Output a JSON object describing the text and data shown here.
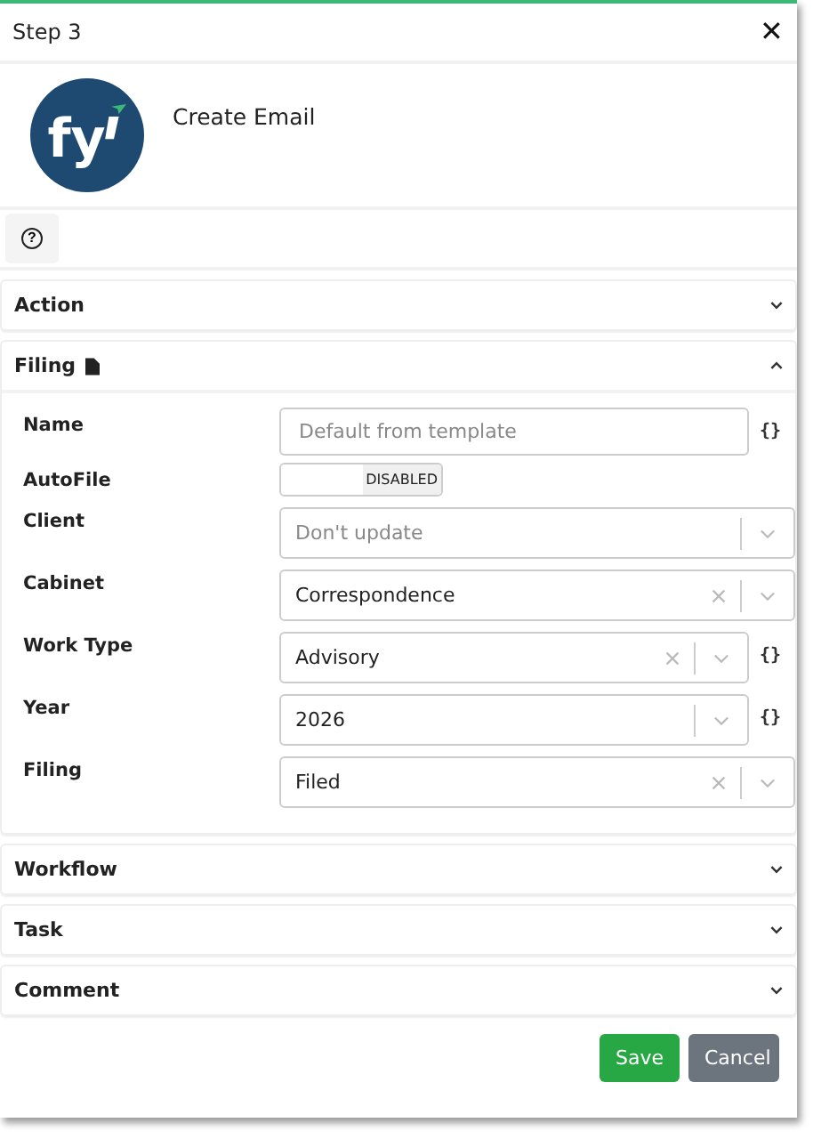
{
  "window": {
    "title": "Step 3",
    "close": "✕"
  },
  "header": {
    "logo_text": "fy",
    "title": "Create Email"
  },
  "help": {
    "icon": "?"
  },
  "sections": [
    {
      "title": "Action",
      "expanded": false,
      "has_icon": false
    },
    {
      "title": "Filing",
      "expanded": true,
      "has_icon": true,
      "fields": [
        {
          "label": "Name",
          "kind": "text",
          "placeholder": "Default from template",
          "variable": "{}"
        },
        {
          "label": "AutoFile",
          "kind": "toggle",
          "on": false,
          "state": "DISABLED"
        },
        {
          "label": "Client",
          "kind": "select",
          "placeholder": "Don't update",
          "clearable": false
        },
        {
          "label": "Cabinet",
          "kind": "select",
          "value": "Correspondence",
          "clearable": true
        },
        {
          "label": "Work Type",
          "kind": "select",
          "value": "Advisory",
          "clearable": true,
          "variable": "{}"
        },
        {
          "label": "Year",
          "kind": "select",
          "value": "2026",
          "clearable": false,
          "variable": "{}"
        },
        {
          "label": "Filing",
          "kind": "select",
          "value": "Filed",
          "clearable": true
        }
      ]
    },
    {
      "title": "Workflow",
      "expanded": false,
      "has_icon": false
    },
    {
      "title": "Task",
      "expanded": false,
      "has_icon": false
    },
    {
      "title": "Comment",
      "expanded": false,
      "has_icon": false
    }
  ],
  "buttons": [
    {
      "label": "Save",
      "kind": "primary"
    },
    {
      "label": "Cancel",
      "kind": "secondary"
    }
  ]
}
